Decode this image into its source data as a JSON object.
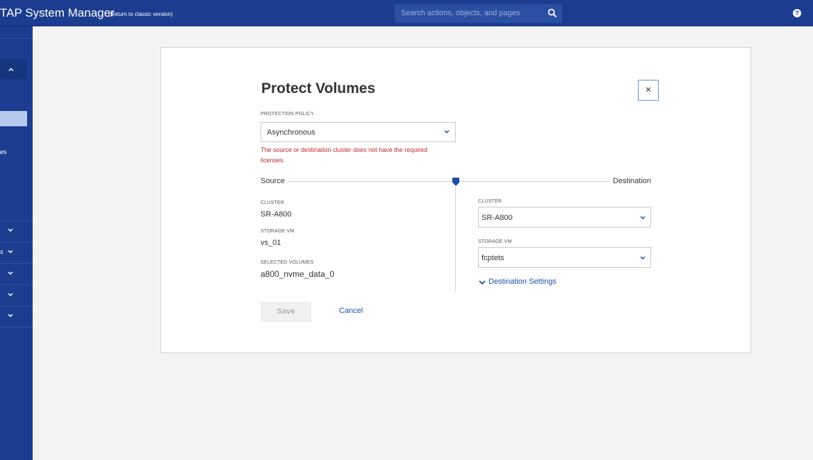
{
  "header": {
    "app_title": "TAP System Manager",
    "classic_link": "(Return to classic version)",
    "search_placeholder": "Search actions, objects, and pages"
  },
  "sidebar": {
    "fragment_1": "es",
    "fragment_2": "s"
  },
  "dialog": {
    "title": "Protect Volumes",
    "protection_policy": {
      "label": "PROTECTION POLICY",
      "value": "Asynchronous",
      "error": "The source or destination cluster does not have the required licenses."
    },
    "source_label": "Source",
    "destination_label": "Destination",
    "source": {
      "cluster_label": "CLUSTER",
      "cluster_value": "SR-A800",
      "svm_label": "STORAGE VM",
      "svm_value": "vs_01",
      "volumes_label": "SELECTED VOLUMES",
      "volumes_value": "a800_nvme_data_0"
    },
    "destination": {
      "cluster_label": "CLUSTER",
      "cluster_value": "SR-A800",
      "svm_label": "STORAGE VM",
      "svm_value": "fcptets",
      "settings_link": "Destination Settings"
    },
    "save_label": "Save",
    "cancel_label": "Cancel",
    "close_glyph": "×"
  },
  "colors": {
    "topbar": "#1c3d8f",
    "accent": "#1c4fa6",
    "error": "#c1272d"
  }
}
